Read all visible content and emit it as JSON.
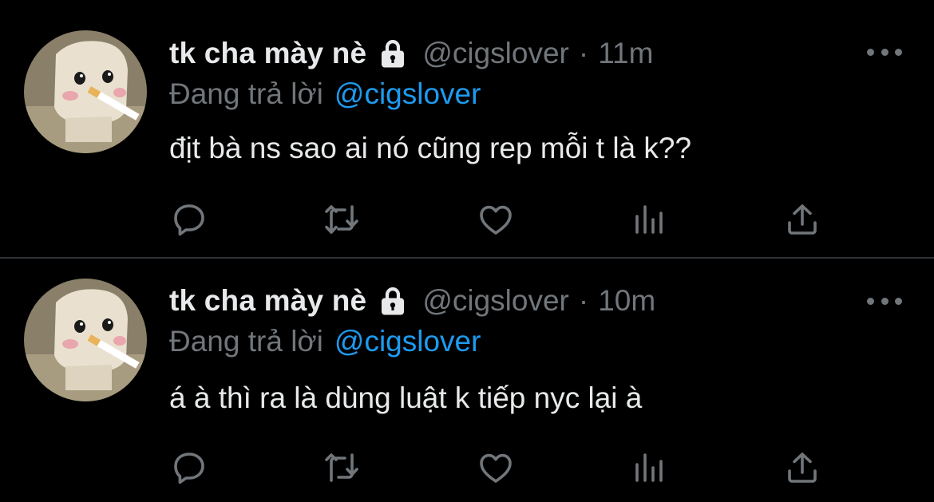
{
  "colors": {
    "background": "#000000",
    "text_primary": "#e7e9ea",
    "text_secondary": "#71767b",
    "accent": "#1d9bf0",
    "divider": "#2f3336"
  },
  "tweets": [
    {
      "display_name": "tk cha mày nè",
      "protected_icon": "lock-icon",
      "handle": "@cigslover",
      "separator": "·",
      "time": "11m",
      "reply_prefix": "Đang trả lời",
      "reply_to": "@cigslover",
      "text": "địt bà ns sao ai nó cũng rep mỗi t là k??",
      "actions": [
        "reply-icon",
        "retweet-icon",
        "like-icon",
        "stats-icon",
        "share-icon"
      ]
    },
    {
      "display_name": "tk cha mày nè",
      "protected_icon": "lock-icon",
      "handle": "@cigslover",
      "separator": "·",
      "time": "10m",
      "reply_prefix": "Đang trả lời",
      "reply_to": "@cigslover",
      "text": "á à thì ra là dùng luật k tiếp nyc lại à",
      "actions": [
        "reply-icon",
        "retweet-icon",
        "like-icon",
        "stats-icon",
        "share-icon"
      ]
    }
  ]
}
